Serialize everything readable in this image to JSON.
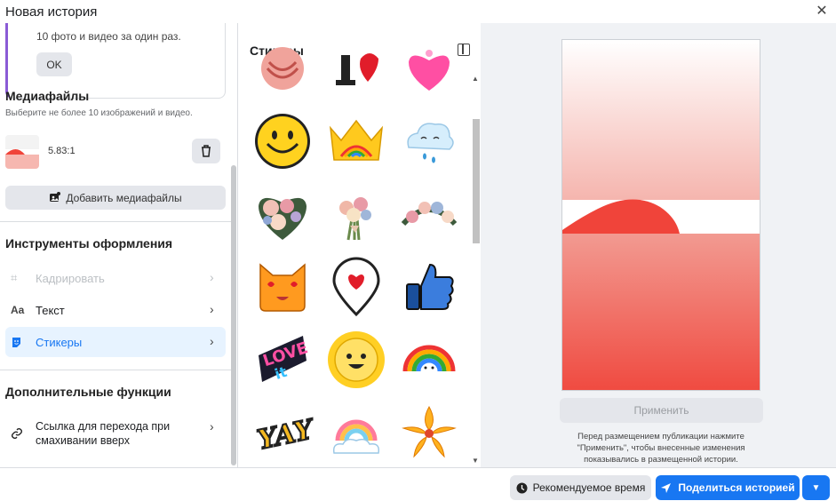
{
  "window": {
    "title": "Новая история"
  },
  "tip": {
    "text": "10 фото и видео за один раз.",
    "ok_label": "OK"
  },
  "media": {
    "title": "Медиафайлы",
    "subtitle": "Выберите не более 10 изображений и видео.",
    "item_ratio": "5.83:1",
    "add_label": "Добавить медиафайлы"
  },
  "tools": {
    "title": "Инструменты оформления",
    "items": [
      {
        "label": "Кадрировать",
        "icon": "crop-icon",
        "state": "disabled"
      },
      {
        "label": "Текст",
        "icon": "text-icon",
        "state": "normal"
      },
      {
        "label": "Стикеры",
        "icon": "sticker-icon",
        "state": "active"
      }
    ]
  },
  "extra": {
    "title": "Дополнительные функции",
    "link_label_line1": "Ссылка для перехода при",
    "link_label_line2": "смахивании вверх"
  },
  "stickers": {
    "title": "Стикеры",
    "items": [
      "pink-knot-sticker",
      "heart-hat-sticker",
      "pink-heart-sticker",
      "smiley-face-sticker",
      "rainbow-crown-sticker",
      "crying-cloud-sticker",
      "flower-heart-sticker",
      "flower-bouquet-sticker",
      "flower-wreath-sticker",
      "heart-eyes-cat-sticker",
      "heart-location-pin-sticker",
      "thumbs-up-sticker",
      "love-it-sticker",
      "smiling-sun-sticker",
      "rainbow-face-sticker",
      "yay-sticker",
      "rainbow-cloud-sticker",
      "orange-flower-sticker"
    ]
  },
  "preview": {
    "apply_label": "Применить",
    "note": "Перед размещением публикации нажмите \"Применить\", чтобы внесенные изменения показывались в размещенной истории."
  },
  "footer": {
    "recommended_time_label": "Рекомендуемое время",
    "share_label": "Поделиться историей"
  },
  "colors": {
    "accent": "#1877f2",
    "tip_bar": "#8a5bd6",
    "preview_red": "#f0443a"
  }
}
